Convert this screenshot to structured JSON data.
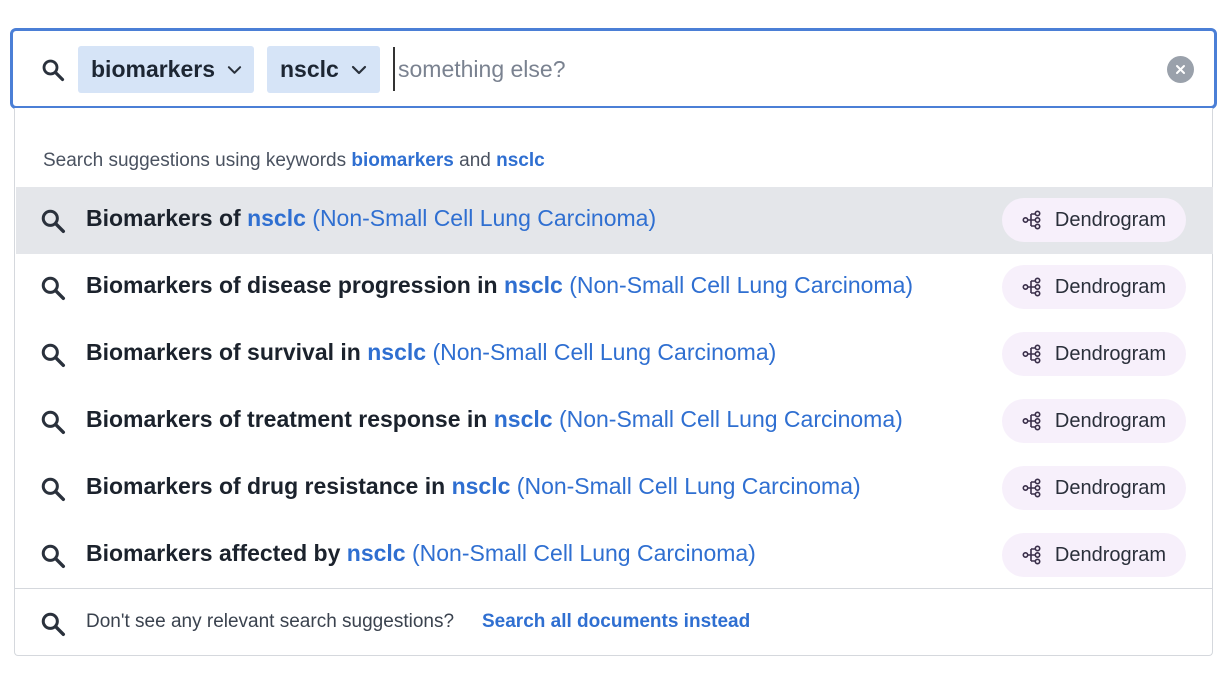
{
  "search": {
    "chips": [
      {
        "label": "biomarkers"
      },
      {
        "label": "nsclc"
      }
    ],
    "input_value": "",
    "placeholder": "something else?"
  },
  "suggestions": {
    "header_prefix": "Search suggestions using keywords ",
    "header_kw1": "biomarkers",
    "header_and": " and ",
    "header_kw2": "nsclc",
    "items": [
      {
        "prefix": "Biomarkers of ",
        "keyword": "nsclc",
        "expansion": " (Non-Small Cell Lung Carcinoma)",
        "action": "Dendrogram"
      },
      {
        "prefix": "Biomarkers of disease progression in ",
        "keyword": "nsclc",
        "expansion": " (Non-Small Cell Lung Carcinoma)",
        "action": "Dendrogram"
      },
      {
        "prefix": "Biomarkers of survival in ",
        "keyword": "nsclc",
        "expansion": " (Non-Small Cell Lung Carcinoma)",
        "action": "Dendrogram"
      },
      {
        "prefix": "Biomarkers of treatment response in ",
        "keyword": "nsclc",
        "expansion": " (Non-Small Cell Lung Carcinoma)",
        "action": "Dendrogram"
      },
      {
        "prefix": "Biomarkers of drug resistance in ",
        "keyword": "nsclc",
        "expansion": " (Non-Small Cell Lung Carcinoma)",
        "action": "Dendrogram"
      },
      {
        "prefix": "Biomarkers affected by ",
        "keyword": "nsclc",
        "expansion": " (Non-Small Cell Lung Carcinoma)",
        "action": "Dendrogram"
      }
    ]
  },
  "footer": {
    "text": "Don't see any relevant search suggestions?",
    "link": "Search all documents instead"
  },
  "icons": {
    "search": "search-icon",
    "chevron": "chevron-down-icon",
    "clear": "close-icon",
    "dendrogram": "dendrogram-icon"
  },
  "colors": {
    "accent": "#2f6fd1",
    "focus_border": "#4b7fd6",
    "chip_bg": "#d6e4f7",
    "active_row": "#e4e6ea",
    "dendrogram_pill": "#f7f0fb"
  }
}
